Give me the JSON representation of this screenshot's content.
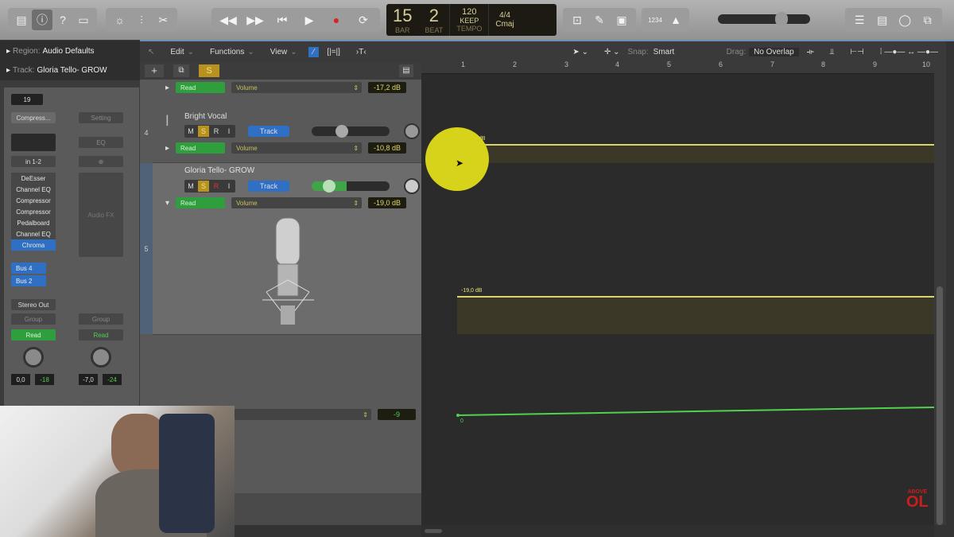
{
  "toolbar": {
    "left_icons": [
      "library-icon",
      "inspector-icon",
      "quick-help-icon",
      "toolbar-icon"
    ],
    "edit_icons": [
      "smart-controls-icon",
      "mixer-icon",
      "scissors-icon"
    ],
    "transport": [
      "rewind-icon",
      "fast-forward-icon",
      "go-to-start-icon",
      "play-icon",
      "record-icon",
      "cycle-icon"
    ],
    "lcd": {
      "bar": "15",
      "beat": "2",
      "bar_label": "BAR",
      "beat_label": "BEAT",
      "tempo": "120",
      "tempo_label": "KEEP",
      "tempo_sub": "TEMPO",
      "signature": "4/4",
      "key": "Cmaj"
    },
    "right_icons": [
      "list-editors-icon",
      "pencil-icon",
      "note-pad-icon"
    ],
    "count_in": "1234",
    "metronome": "metronome-icon",
    "master_volume_percent": 70,
    "far_right_icons": [
      "list-icon",
      "note-pad-icon",
      "loops-icon",
      "browser-icon"
    ]
  },
  "inspector": {
    "region_label": "Region:",
    "region_value": "Audio Defaults",
    "track_label": "Track:",
    "track_value": "Gloria Tello- GROW",
    "strip1": {
      "field": "19",
      "setting": "Compress...",
      "input": "in 1-2",
      "plugins": [
        "DeEsser",
        "Channel EQ",
        "Compressor",
        "Compressor",
        "Pedalboard",
        "Channel EQ",
        "Chroma"
      ],
      "selected_plugin": "Chroma",
      "sends": [
        "Bus 4",
        "Bus 2"
      ],
      "output": "Stereo Out",
      "group": "Group",
      "automation": "Read",
      "pan": "0",
      "volume": "0,0",
      "meter": "-18"
    },
    "strip2": {
      "setting": "Setting",
      "eq": "EQ",
      "audio_fx": "Audio FX",
      "group": "Group",
      "automation": "Read",
      "volume": "-7,0",
      "meter": "-24"
    }
  },
  "menubar": {
    "items": [
      "Edit",
      "Functions",
      "View"
    ],
    "snap_label": "Snap:",
    "snap_value": "Smart",
    "drag_label": "Drag:",
    "drag_value": "No Overlap"
  },
  "tracks": [
    {
      "number": "",
      "name": "",
      "automation": "Read",
      "parameter": "Volume",
      "value": "-17,2 dB"
    },
    {
      "number": "4",
      "name": "Bright Vocal",
      "mute": "M",
      "solo": "S",
      "record": "R",
      "input": "I",
      "track_btn": "Track",
      "automation": "Read",
      "parameter": "Volume",
      "value": "-10,8 dB",
      "fader_percent": 40
    },
    {
      "number": "5",
      "name": "Gloria Tello- GROW",
      "mute": "M",
      "solo": "S",
      "record": "R",
      "input": "I",
      "track_btn": "Track",
      "automation": "Read",
      "parameter": "Volume",
      "value": "-19,0 dB",
      "fader_percent": 22
    },
    {
      "number": "",
      "value": "-9"
    }
  ],
  "ruler": {
    "bars": [
      "1",
      "2",
      "3",
      "4",
      "5",
      "6",
      "7",
      "8",
      "9",
      "10"
    ]
  },
  "automation": {
    "lane1_label": "-10,8 dB",
    "lane2_label": "-19,0 dB",
    "lane3_label": "0"
  },
  "watermark": {
    "line1": "ABOVE",
    "line2": "OL"
  },
  "colors": {
    "accent_blue": "#2f6fc4",
    "read_green": "#2f9e3d",
    "automation_yellow": "#d8d36a",
    "solo_yellow": "#b8921f",
    "record_red": "#d8202a"
  }
}
